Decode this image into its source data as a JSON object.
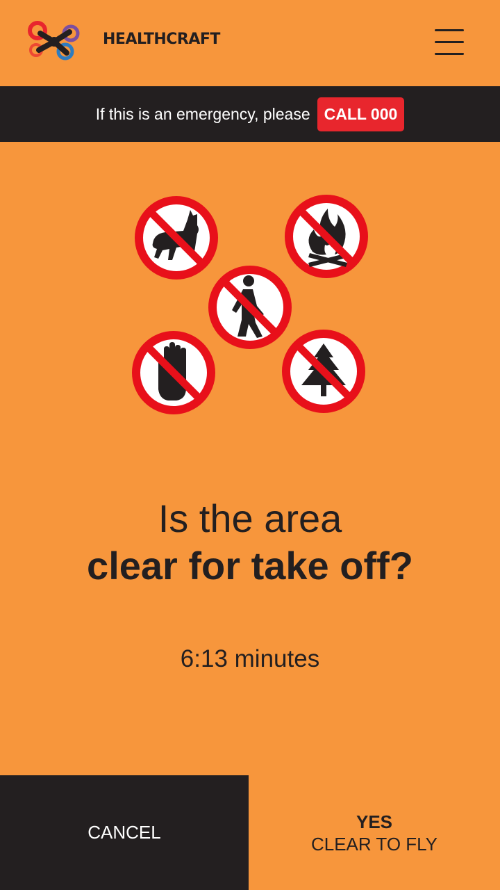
{
  "header": {
    "brand": "HEALTHCRAFT",
    "logo_icon": "drone-logo-icon",
    "menu_icon": "hamburger-menu-icon"
  },
  "emergency": {
    "text": "If this is an emergency, please",
    "call_label": "CALL 000"
  },
  "signs": [
    {
      "name": "no-dogs-icon"
    },
    {
      "name": "no-fire-icon"
    },
    {
      "name": "no-pedestrians-icon"
    },
    {
      "name": "no-touching-icon"
    },
    {
      "name": "no-trees-icon"
    }
  ],
  "question": {
    "line1": "Is the area",
    "line2": "clear for take off?"
  },
  "timer": "6:13 minutes",
  "actions": {
    "cancel_label": "CANCEL",
    "yes_title": "YES",
    "yes_sub": "CLEAR TO FLY"
  },
  "colors": {
    "background": "#F7963C",
    "dark": "#231F20",
    "alert_red": "#E8262D"
  }
}
